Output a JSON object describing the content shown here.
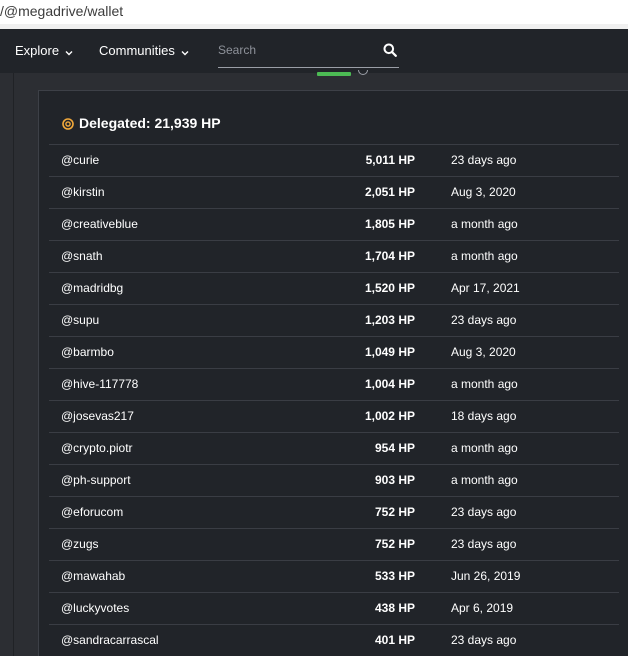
{
  "browser": {
    "url": "/@megadrive/wallet"
  },
  "nav": {
    "explore_label": "Explore",
    "communities_label": "Communities",
    "search_placeholder": "Search"
  },
  "delegations": {
    "title": "Delegated: 21,939 HP",
    "accent_color": "#f2a93b",
    "rows": [
      {
        "name": "@curie",
        "amount": "5,011 HP",
        "date": "23 days ago"
      },
      {
        "name": "@kirstin",
        "amount": "2,051 HP",
        "date": "Aug 3, 2020"
      },
      {
        "name": "@creativeblue",
        "amount": "1,805 HP",
        "date": "a month ago"
      },
      {
        "name": "@snath",
        "amount": "1,704 HP",
        "date": "a month ago"
      },
      {
        "name": "@madridbg",
        "amount": "1,520 HP",
        "date": "Apr 17, 2021"
      },
      {
        "name": "@supu",
        "amount": "1,203 HP",
        "date": "23 days ago"
      },
      {
        "name": "@barmbo",
        "amount": "1,049 HP",
        "date": "Aug 3, 2020"
      },
      {
        "name": "@hive-117778",
        "amount": "1,004 HP",
        "date": "a month ago"
      },
      {
        "name": "@josevas217",
        "amount": "1,002 HP",
        "date": "18 days ago"
      },
      {
        "name": "@crypto.piotr",
        "amount": "954 HP",
        "date": "a month ago"
      },
      {
        "name": "@ph-support",
        "amount": "903 HP",
        "date": "a month ago"
      },
      {
        "name": "@eforucom",
        "amount": "752 HP",
        "date": "23 days ago"
      },
      {
        "name": "@zugs",
        "amount": "752 HP",
        "date": "23 days ago"
      },
      {
        "name": "@mawahab",
        "amount": "533 HP",
        "date": "Jun 26, 2019"
      },
      {
        "name": "@luckyvotes",
        "amount": "438 HP",
        "date": "Apr 6, 2019"
      },
      {
        "name": "@sandracarrascal",
        "amount": "401 HP",
        "date": "23 days ago"
      }
    ]
  }
}
